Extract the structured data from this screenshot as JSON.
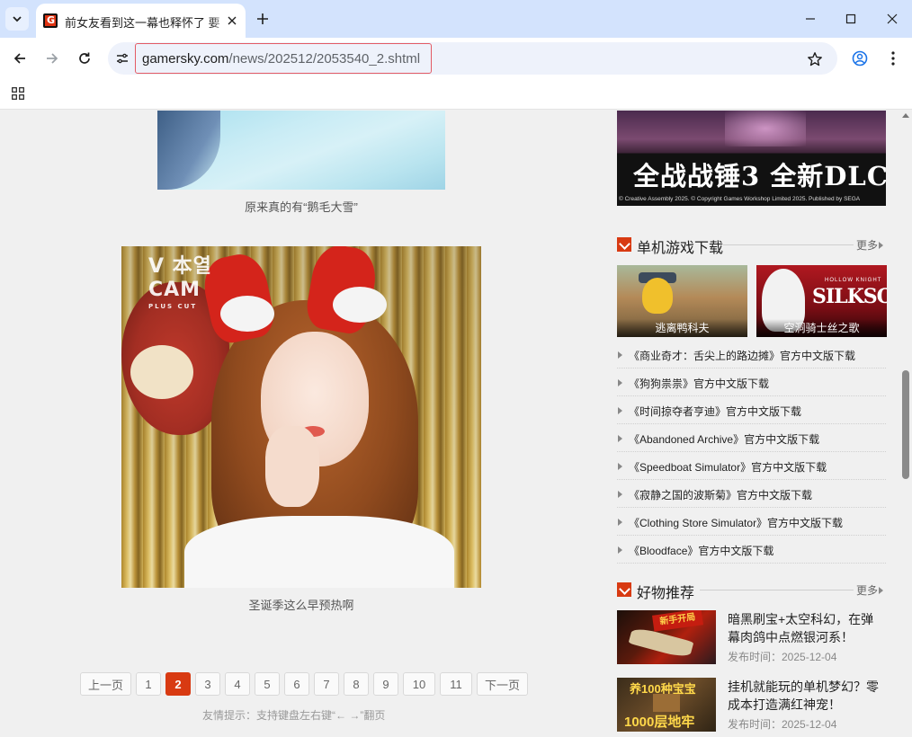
{
  "browser": {
    "tab_title": "前女友看到这一幕也释怀了 要",
    "url_host": "gamersky.com",
    "url_path": "/news/202512/2053540_2.shtml"
  },
  "article": {
    "caption_top": "原来真的有“鹅毛大雪”",
    "photo_logo": "V 本열",
    "photo_logo2": "CAM",
    "photo_logo_sub": "PLUS CUT",
    "caption_photo": "圣诞季这么早预热啊",
    "pager": {
      "prev": "上一页",
      "pages": [
        "1",
        "2",
        "3",
        "4",
        "5",
        "6",
        "7",
        "8",
        "9",
        "10",
        "11"
      ],
      "current": "2",
      "next": "下一页",
      "tip": "友情提示：支持键盘左右键“← →”翻页"
    }
  },
  "sidebar": {
    "banner_title": "全战战锤3 全新DLC",
    "banner_copyright": "© Creative Assembly 2025. © Copyright Games Workshop Limited 2025. Published by SEGA",
    "downloads": {
      "title": "单机游戏下载",
      "more": "更多",
      "featured": [
        {
          "label": "逃离鸭科夫"
        },
        {
          "label": "空洞骑士丝之歌",
          "art_text": "SILKSONG",
          "art_sub": "HOLLOW KNIGHT"
        }
      ],
      "items": [
        "《商业奇才：舌尖上的路边摊》官方中文版下载",
        "《狗狗祟祟》官方中文版下载",
        "《时间掠夺者亨迪》官方中文版下载",
        "《Abandoned Archive》官方中文版下载",
        "《Speedboat Simulator》官方中文版下载",
        "《寂静之国的波斯菊》官方中文版下载",
        "《Clothing Store Simulator》官方中文版下载",
        "《Bloodface》官方中文版下载"
      ]
    },
    "recommend": {
      "title": "好物推荐",
      "more": "更多",
      "items": [
        {
          "title": "暗黑刷宝+太空科幻，在弹幕肉鸽中点燃银河系！",
          "date": "发布时间：2025-12-04",
          "art_text": "新手开局"
        },
        {
          "title": "挂机就能玩的单机梦幻？零成本打造满红神宠！",
          "date": "发布时间：2025-12-04",
          "art_text": "养100种宝宝",
          "art_text2": "1000层地牢"
        }
      ]
    }
  }
}
